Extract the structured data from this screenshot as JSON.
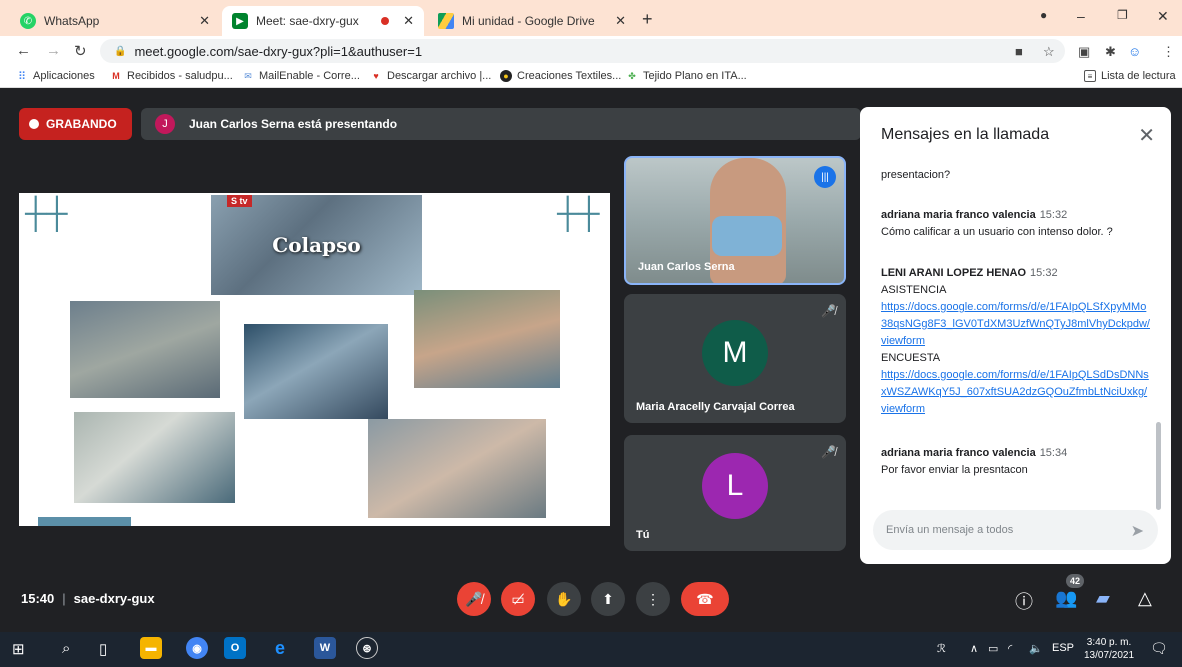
{
  "browser": {
    "tabs": [
      {
        "title": "WhatsApp",
        "active": false
      },
      {
        "title": "Meet: sae-dxry-gux",
        "active": true
      },
      {
        "title": "Mi unidad - Google Drive",
        "active": false
      }
    ],
    "url": "meet.google.com/sae-dxry-gux?pli=1&authuser=1",
    "bookmarks": [
      "Aplicaciones",
      "Recibidos - saludpu...",
      "MailEnable - Corre...",
      "Descargar archivo |...",
      "Creaciones Textiles...",
      "Tejido Plano en ITA..."
    ],
    "reading_list": "Lista de lectura"
  },
  "meet": {
    "recording_label": "GRABANDO",
    "presenter_initial": "J",
    "presenting_text": "Juan Carlos Serna está presentando",
    "slide_title": "Colapso",
    "slide_badge": "S tv",
    "participants": [
      {
        "name": "Juan Carlos Serna",
        "initial": "",
        "color": "#1a73e8"
      },
      {
        "name": "Maria Aracelly Carvajal Correa",
        "initial": "M",
        "color": "#0f5c49"
      },
      {
        "name": "Tú",
        "initial": "L",
        "color": "#9c27b0"
      }
    ],
    "time": "15:40",
    "meeting_code": "sae-dxry-gux",
    "people_count": "42"
  },
  "chat": {
    "title": "Mensajes en la llamada",
    "messages": [
      {
        "sender": "",
        "time": "",
        "lines": [
          "presentacion?"
        ],
        "links": []
      },
      {
        "sender": "adriana maria franco valencia",
        "time": "15:32",
        "lines": [
          "Cómo calificar a un usuario con intenso dolor. ?"
        ],
        "links": []
      },
      {
        "sender": "LENI ARANI LOPEZ HENAO",
        "time": "15:32",
        "lines": [
          "ASISTENCIA"
        ],
        "links": [
          "https://docs.google.com/forms/d/e/1FAIpQLSfXpyMMo38qsNGg8F3_lGV0TdXM3UzfWnQTyJ8mlVhyDckpdw/viewform"
        ],
        "lines2": [
          "ENCUESTA"
        ],
        "links2": [
          "https://docs.google.com/forms/d/e/1FAIpQLSdDsDNNsxWSZAWKqY5J_607xftSUA2dzGQOuZfmbLtNciUxkg/viewform"
        ]
      },
      {
        "sender": "adriana maria franco valencia",
        "time": "15:34",
        "lines": [
          "Por favor enviar la presntacon"
        ],
        "links": []
      }
    ],
    "input_placeholder": "Envía un mensaje a todos"
  },
  "taskbar": {
    "lang": "ESP",
    "time": "3:40 p. m.",
    "date": "13/07/2021"
  },
  "colors": {
    "meet_bg": "#202124",
    "danger": "#ea4335",
    "link": "#1a73e8"
  }
}
